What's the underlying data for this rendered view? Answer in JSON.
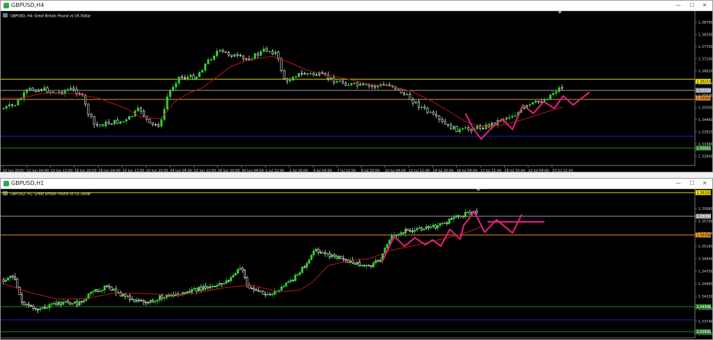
{
  "windows": [
    {
      "title": "GBPUSD,H4",
      "caption": "GBPUSD, H4:  Great Britain Pound vs US Dollar",
      "price_ticks": [
        "1.38780",
        "1.38240",
        "1.37700",
        "1.37160",
        "1.36620",
        "1.36080",
        "1.35540",
        "1.35000",
        "1.34460",
        "1.33920",
        "1.33380",
        "1.32840"
      ],
      "time_ticks": [
        "10 Jun 2025",
        "12 Jun 04:00",
        "13 Jun 12:00",
        "16 Jun 20:00",
        "18 Jun 04:00",
        "19 Jun 12:00",
        "20 Jun 20:00",
        "24 Jun 04:00",
        "25 Jun 12:00",
        "26 Jun 20:00",
        "30 Jun 04:00",
        "1 Jul 12:00",
        "2 Jul 20:00",
        "4 Jul 04:00",
        "7 Jul 12:00",
        "8 Jul 20:00",
        "10 Jul 04:00",
        "11 Jul 12:00",
        "14 Jul 20:00",
        "16 Jul 04:00",
        "17 Jul 12:00",
        "18 Jul 20:00",
        "22 Jul 04:00",
        "23 Jul 12:00"
      ],
      "price_tags": [
        {
          "label": "1.36214",
          "bg": "#f2e600",
          "fg": "#000000"
        },
        {
          "label": "1.35700",
          "bg": "#9a9aa8",
          "fg": "#ffffff"
        },
        {
          "label": "1.35042",
          "bg": "#e8962c",
          "fg": "#000000"
        },
        {
          "label": "1.33011",
          "bg": "#2e8b2e",
          "fg": "#ffffff"
        }
      ],
      "controls": {
        "minimize": "—",
        "maximize": "☐",
        "close": "✕"
      }
    },
    {
      "title": "GBPUSD,H1",
      "caption": "GBPUSD, H1:  Great Britain Pound vs US Dollar",
      "price_ticks": [
        "1.35960",
        "1.35700",
        "1.35420",
        "1.35180",
        "1.34940",
        "1.34700",
        "1.34460",
        "1.34220",
        "1.33980",
        "1.33740",
        "1.33500"
      ],
      "time_ticks": [],
      "price_tags": [
        {
          "label": "1.36193",
          "bg": "#f2e600",
          "fg": "#000000"
        },
        {
          "label": "1.35700",
          "bg": "#9a9aa8",
          "fg": "#ffffff"
        },
        {
          "label": "1.35339",
          "bg": "#e8962c",
          "fg": "#000000"
        },
        {
          "label": "1.34346",
          "bg": "#2e8b2e",
          "fg": "#ffffff"
        },
        {
          "label": "1.33500",
          "bg": "#2e8b2e",
          "fg": "#ffffff"
        }
      ],
      "controls": {
        "minimize": "—",
        "maximize": "☐",
        "close": "✕"
      }
    }
  ],
  "colors": {
    "bull": "#39d13a",
    "bear": "#ffffff",
    "ma": "#c01818",
    "annotation": "#e0217a",
    "yellow": "#f2e600",
    "gray": "#a0a0a8",
    "orange": "#e8962c",
    "blue": "#2424d8",
    "green": "#1f8a1f"
  }
}
